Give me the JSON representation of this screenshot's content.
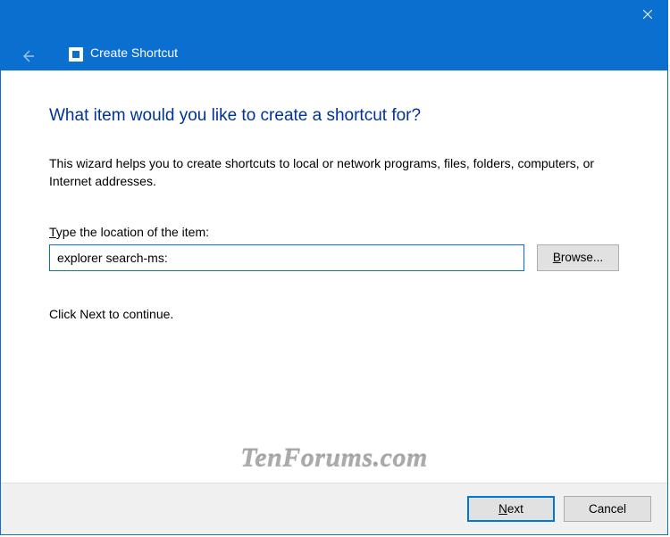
{
  "window": {
    "title": "Create Shortcut"
  },
  "page": {
    "heading": "What item would you like to create a shortcut for?",
    "description": "This wizard helps you to create shortcuts to local or network programs, files, folders, computers, or Internet addresses.",
    "field_label_prefix": "T",
    "field_label_rest": "ype the location of the item:",
    "location_value": "explorer search-ms:",
    "browse_prefix": "B",
    "browse_rest": "rowse...",
    "continue_text": "Click Next to continue."
  },
  "footer": {
    "next_prefix": "N",
    "next_rest": "ext",
    "cancel": "Cancel"
  },
  "watermark": "TenForums.com"
}
